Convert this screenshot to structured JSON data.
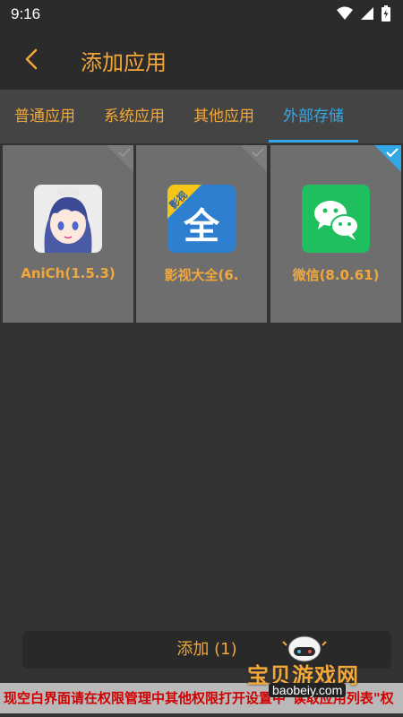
{
  "status_bar": {
    "time": "9:16"
  },
  "header": {
    "title": "添加应用"
  },
  "tabs": [
    {
      "label": "普通应用"
    },
    {
      "label": "系统应用"
    },
    {
      "label": "其他应用"
    },
    {
      "label": "外部存储",
      "active": true
    }
  ],
  "apps": [
    {
      "name": "AniCh(1.5.3)",
      "icon": "anime-girl-avatar-icon",
      "selected": false
    },
    {
      "name": "影视大全(6.",
      "icon": "yingshi-daquan-icon",
      "selected": false,
      "badge": "影视",
      "glyph": "全"
    },
    {
      "name": "微信(8.0.61)",
      "icon": "wechat-icon",
      "selected": true
    }
  ],
  "footer": {
    "add_label": "添加 (1)"
  },
  "banner": {
    "text": "现空白界面请在权限管理中其他权限打开设置中\"读取应用列表\"权"
  },
  "watermark": {
    "title": "宝贝游戏网",
    "domain": "baobeiy.com"
  },
  "colors": {
    "accent": "#f2a73b",
    "tab_active": "#34a7e6",
    "banner_text": "#d00000"
  }
}
